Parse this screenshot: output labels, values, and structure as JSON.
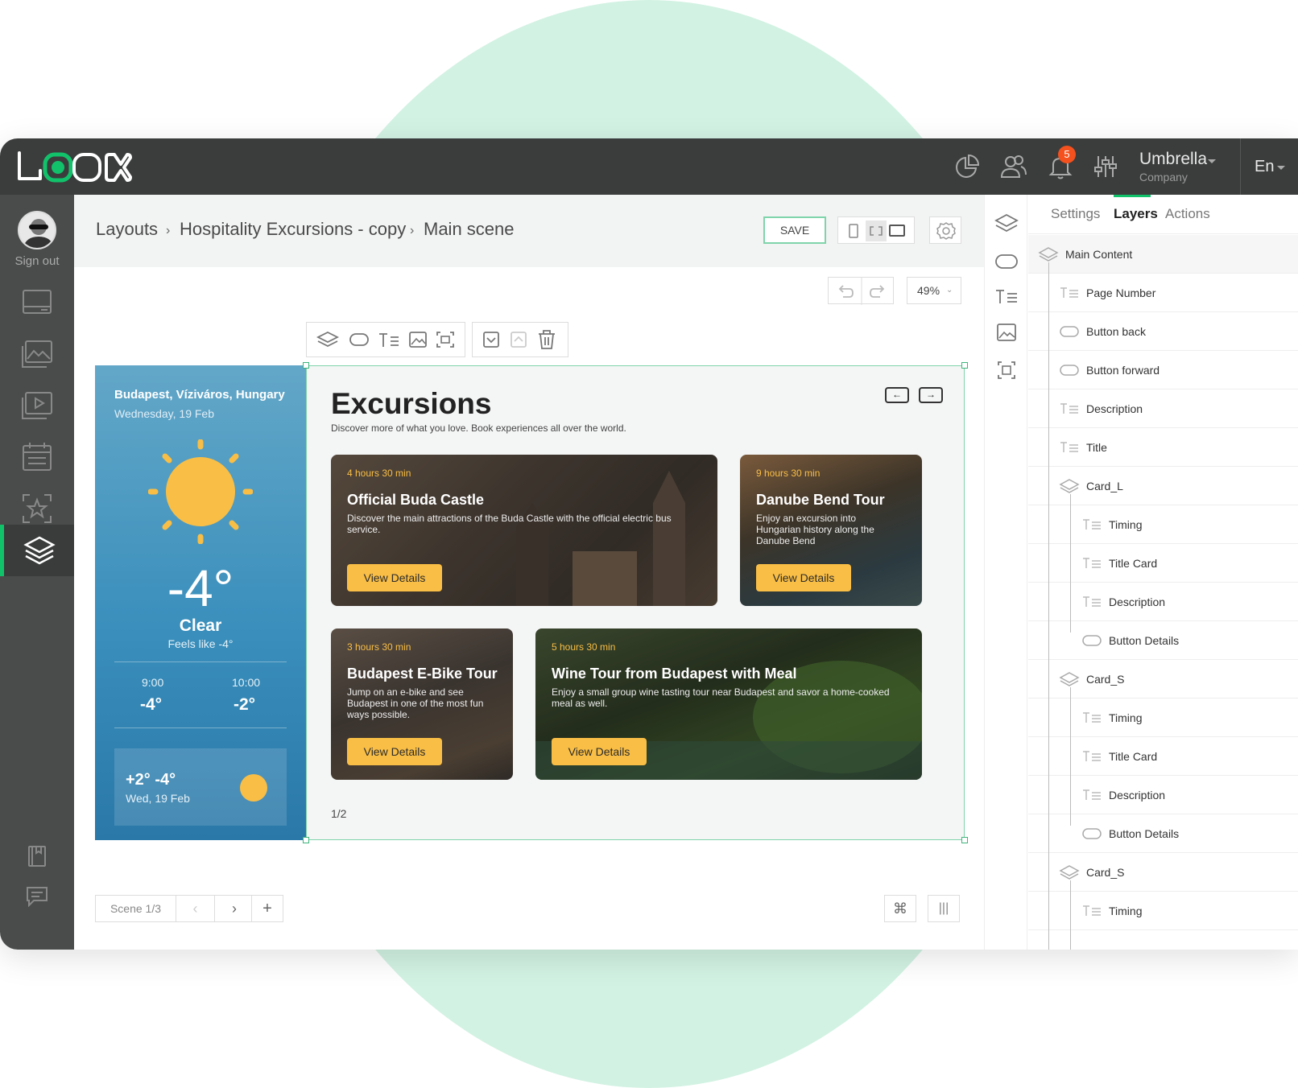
{
  "app": {
    "logo_text": "LOOK",
    "company_name": "Umbrella",
    "company_sub": "Company",
    "notifications_count": "5",
    "language": "En",
    "accent_color": "#12c26b"
  },
  "sidebar": {
    "sign_out": "Sign out",
    "items": [
      {
        "icon": "monitor-icon"
      },
      {
        "icon": "gallery-icon"
      },
      {
        "icon": "video-icon"
      },
      {
        "icon": "calendar-icon"
      },
      {
        "icon": "star-frame-icon"
      },
      {
        "icon": "layers-icon",
        "active": true
      }
    ],
    "bottom": [
      {
        "icon": "book-icon"
      },
      {
        "icon": "chat-icon"
      }
    ]
  },
  "breadcrumb": {
    "items": [
      "Layouts",
      "Hospitality Excursions - copy",
      "Main scene"
    ]
  },
  "toolbar": {
    "save_label": "SAVE",
    "zoom": "49%"
  },
  "weather": {
    "location": "Budapest, Víziváros, Hungary",
    "date": "Wednesday, 19 Feb",
    "temp": "-4°",
    "condition": "Clear",
    "feels_like": "Feels like -4°",
    "hours": [
      {
        "time": "9:00",
        "temp": "-4°"
      },
      {
        "time": "10:00",
        "temp": "-2°"
      }
    ],
    "forecast": {
      "range": "+2° -4°",
      "date": "Wed, 19 Feb"
    }
  },
  "excursions": {
    "title": "Excursions",
    "subtitle": "Discover more of what you love. Book experiences all over the world.",
    "page": "1/2",
    "cards": [
      {
        "timing": "4 hours 30 min",
        "title": "Official Buda Castle",
        "description": "Discover the main attractions of the Buda Castle with the official electric bus service.",
        "button": "View Details"
      },
      {
        "timing": "9 hours 30 min",
        "title": "Danube Bend Tour",
        "description": "Enjoy an excursion into Hungarian history along the Danube Bend",
        "button": "View Details"
      },
      {
        "timing": "3 hours 30 min",
        "title": "Budapest E-Bike Tour",
        "description": "Jump on an e-bike and see Budapest in one of the most fun ways possible.",
        "button": "View Details"
      },
      {
        "timing": "5 hours 30 min",
        "title": "Wine Tour from Budapest with Meal",
        "description": "Enjoy a small group wine tasting tour near Budapest and savor a home-cooked meal as well.",
        "button": "View Details"
      }
    ]
  },
  "scene": {
    "label": "Scene 1/3"
  },
  "right_panel": {
    "tabs": [
      "Settings",
      "Layers",
      "Actions"
    ],
    "active_tab": "Layers",
    "layers": [
      {
        "name": "Main Content",
        "type": "group",
        "indent": 0
      },
      {
        "name": "Page Number",
        "type": "text",
        "indent": 1
      },
      {
        "name": "Button back",
        "type": "button",
        "indent": 1
      },
      {
        "name": "Button forward",
        "type": "button",
        "indent": 1
      },
      {
        "name": "Description",
        "type": "text",
        "indent": 1
      },
      {
        "name": "Title",
        "type": "text",
        "indent": 1
      },
      {
        "name": "Card_L",
        "type": "group",
        "indent": 1
      },
      {
        "name": "Timing",
        "type": "text",
        "indent": 2
      },
      {
        "name": "Title Card",
        "type": "text",
        "indent": 2
      },
      {
        "name": "Description",
        "type": "text",
        "indent": 2
      },
      {
        "name": "Button Details",
        "type": "button",
        "indent": 2
      },
      {
        "name": "Card_S",
        "type": "group",
        "indent": 1
      },
      {
        "name": "Timing",
        "type": "text",
        "indent": 2
      },
      {
        "name": "Title Card",
        "type": "text",
        "indent": 2
      },
      {
        "name": "Description",
        "type": "text",
        "indent": 2
      },
      {
        "name": "Button Details",
        "type": "button",
        "indent": 2
      },
      {
        "name": "Card_S",
        "type": "group",
        "indent": 1
      },
      {
        "name": "Timing",
        "type": "text",
        "indent": 2
      }
    ]
  }
}
